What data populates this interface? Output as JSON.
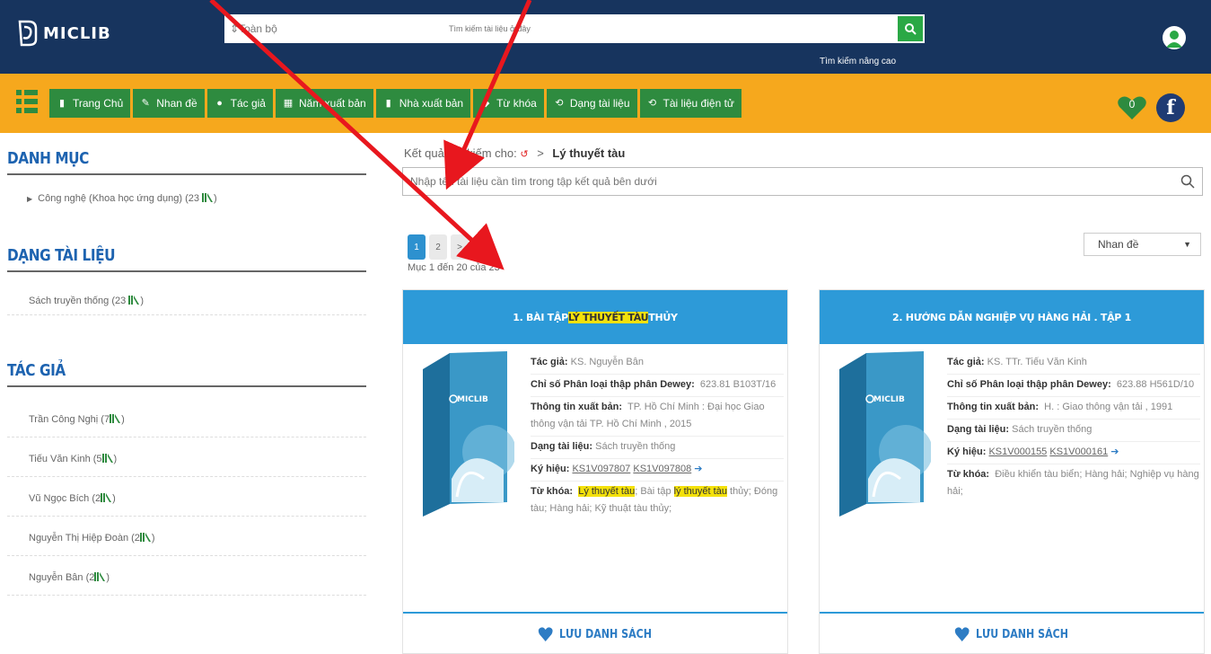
{
  "header": {
    "logo_text": "MICLIB",
    "search_category": "Toàn bộ",
    "search_placeholder": "Tìm kiếm tài liệu ở đây",
    "advanced_search": "Tìm kiếm nâng cao"
  },
  "nav": {
    "items": [
      {
        "label": "Trang Chủ",
        "icon": "home-icon"
      },
      {
        "label": "Nhan đề",
        "icon": "title-icon"
      },
      {
        "label": "Tác giả",
        "icon": "author-icon"
      },
      {
        "label": "Năm xuất bản",
        "icon": "calendar-icon"
      },
      {
        "label": "Nhà xuất bản",
        "icon": "bookmark-icon"
      },
      {
        "label": "Từ khóa",
        "icon": "keyword-icon"
      },
      {
        "label": "Dạng tài liệu",
        "icon": "doc-type-icon"
      },
      {
        "label": "Tài liệu điện tử",
        "icon": "ebook-icon"
      }
    ],
    "favorites_count": "0",
    "facebook": "f"
  },
  "sidebar": {
    "category_title": "DANH MỤC",
    "category_items": [
      "Công nghệ (Khoa học ứng dụng) (23"
    ],
    "doctype_title": "DẠNG TÀI LIỆU",
    "doctype_items": [
      "Sách truyền thống (23"
    ],
    "author_title": "TÁC GIẢ",
    "author_items": [
      "Trần Công Nghị (7",
      "Tiếu Văn Kinh (5",
      "Vũ Ngọc Bích (2",
      "Nguyễn Thị Hiệp Đoàn (2",
      "Nguyễn Bân (2"
    ],
    "close_paren": ")"
  },
  "main": {
    "breadcrumb_prefix": "Kết quả tìm kiếm cho:",
    "breadcrumb_sep": ">",
    "query": "Lý thuyết tàu",
    "refine_placeholder": "Nhập tên tài liệu cần tìm trong tập kết quả bên dưới",
    "pages": [
      "1",
      "2",
      ">"
    ],
    "range_text": "Mục 1 đến 20 của 23",
    "sort_value": "Nhan đề"
  },
  "cards": [
    {
      "title_pre": "1. BÀI TẬP ",
      "title_hl": "LÝ THUYẾT TÀU",
      "title_post": " THỦY",
      "author_label": "Tác giả:",
      "author": "KS. Nguyễn Bân",
      "dewey_label": "Chỉ số Phân loại thập phân Dewey:",
      "dewey": "623.81 B103T/16",
      "pub_label": "Thông tin xuất bản:",
      "pub": "TP. Hồ Chí Minh : Đại học Giao thông vận tải TP. Hồ Chí Minh , 2015",
      "type_label": "Dạng tài liệu:",
      "type": "Sách truyền thống",
      "code_label": "Ký hiệu:",
      "code1": "KS1V097807",
      "code2": "KS1V097808",
      "kw_label": "Từ khóa:",
      "kw_hl1": "Lý thuyết tàu",
      "kw_mid": "; Bài tập ",
      "kw_hl2": "lý thuyết tàu",
      "kw_post": " thủy; Đóng tàu; Hàng hải; Kỹ thuật tàu thủy;",
      "save": "LƯU DANH SÁCH"
    },
    {
      "title_pre": "2. HƯỚNG DẪN NGHIỆP VỤ HÀNG HẢI . TẬP 1",
      "title_hl": "",
      "title_post": "",
      "author_label": "Tác giả:",
      "author": "KS. TTr. Tiếu Văn Kinh",
      "dewey_label": "Chỉ số Phân loại thập phân Dewey:",
      "dewey": "623.88 H561D/10",
      "pub_label": "Thông tin xuất bản:",
      "pub": "H. : Giao thông vận tải , 1991",
      "type_label": "Dạng tài liệu:",
      "type": "Sách truyền thống",
      "code_label": "Ký hiệu:",
      "code1": "KS1V000155",
      "code2": "KS1V000161",
      "kw_label": "Từ khóa:",
      "kw_hl1": "",
      "kw_mid": "",
      "kw_hl2": "",
      "kw_post": "Điều khiển tàu biển; Hàng hải; Nghiệp vụ hàng hải;",
      "save": "LƯU DANH SÁCH"
    }
  ],
  "colors": {
    "header_bg": "#17345e",
    "nav_bg": "#f6a81d",
    "nav_btn": "#2e8b3f",
    "card_head": "#2d9ad8",
    "section_title": "#1d63b0",
    "highlight": "#f4e10a",
    "annotation_arrow": "#e8171e"
  }
}
